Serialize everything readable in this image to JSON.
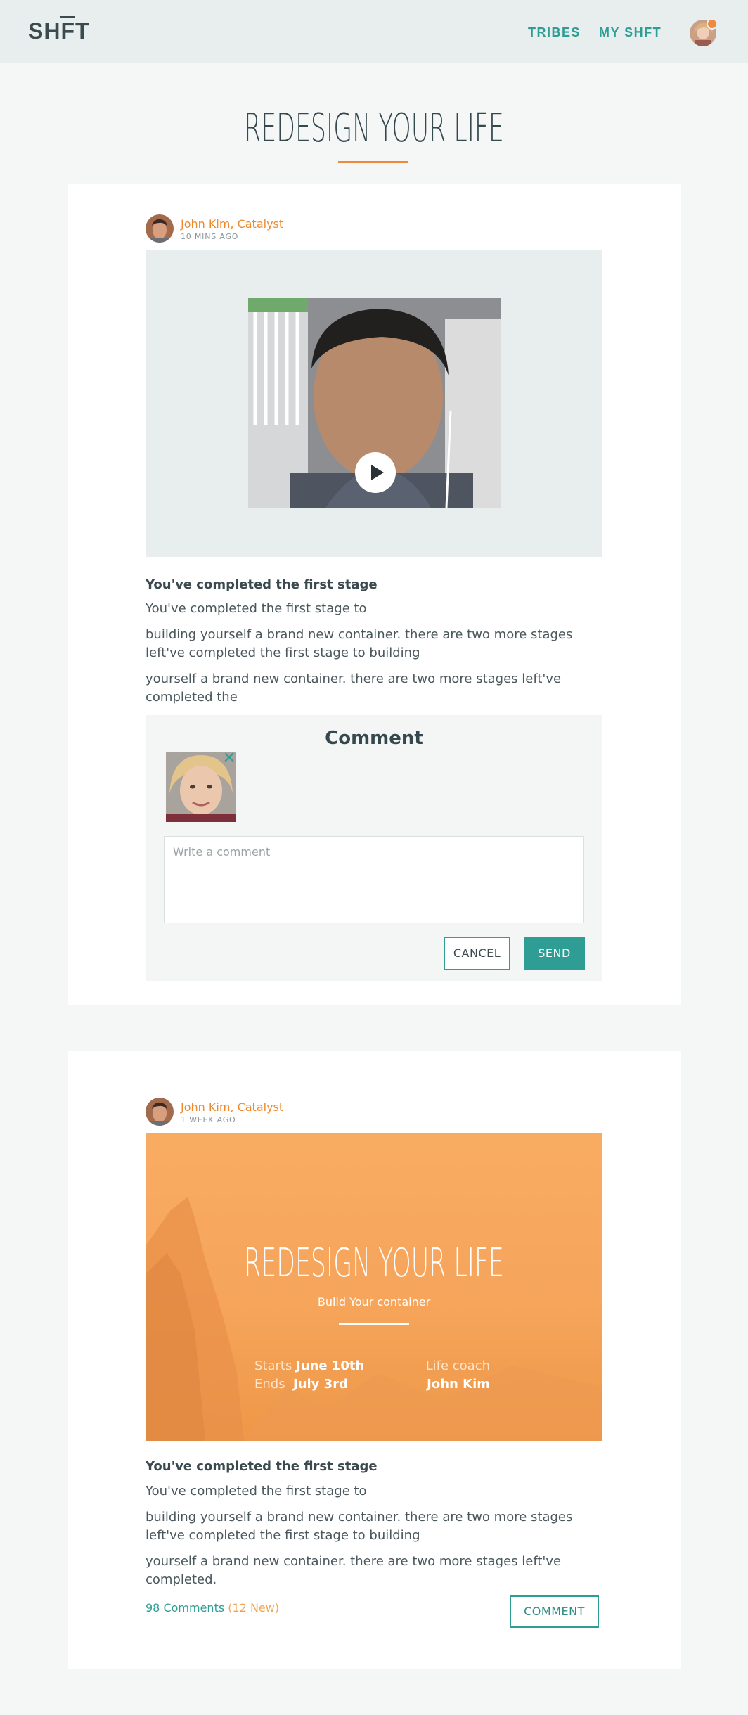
{
  "header": {
    "logo_text": "SHFT",
    "nav": [
      "TRIBES",
      "MY SHFT"
    ],
    "notification_color": "#f1893a"
  },
  "page": {
    "title": "REDESIGN YOUR LIFE",
    "accent": "#f1893a",
    "primary": "#2e9e94"
  },
  "posts": [
    {
      "author": "John Kim, Catalyst",
      "time": "10 MINS AGO",
      "media": "video",
      "title": "You've completed the first stage",
      "paragraphs": [
        "You've completed the first stage to",
        "building yourself a brand new container. there are two more stages left've completed the first stage to building",
        "yourself a brand new container. there are two more stages left've completed the"
      ],
      "comment": {
        "heading": "Comment",
        "placeholder": "Write a comment",
        "value": "",
        "cancel_label": "CANCEL",
        "send_label": "SEND"
      }
    },
    {
      "author": "John Kim, Catalyst",
      "time": "1 WEEK AGO",
      "media": "banner",
      "banner": {
        "title": "REDESIGN YOUR LIFE",
        "subtitle": "Build Your container",
        "starts_label": "Starts",
        "starts_value": "June 10th",
        "ends_label": "Ends",
        "ends_value": "July 3rd",
        "coach_label": "Life coach",
        "coach_value": "John Kim"
      },
      "title": "You've completed the first stage",
      "paragraphs": [
        "You've completed the first stage to",
        "building yourself a brand new container. there are two more stages left've completed the first stage to building",
        "yourself a brand new container. there are two more stages left've completed."
      ],
      "comments_count": "98 Comments",
      "comments_new": "(12 New)",
      "comment_button": "COMMENT"
    }
  ]
}
